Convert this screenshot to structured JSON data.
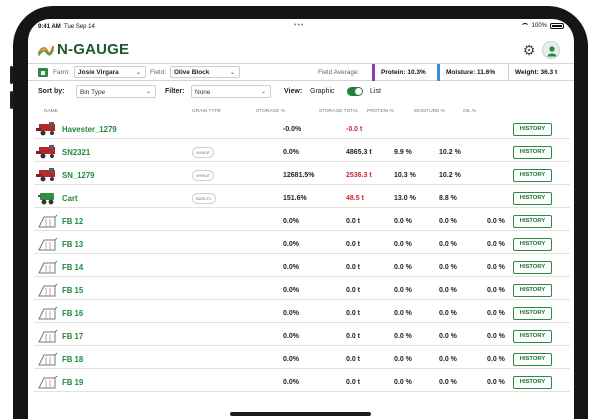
{
  "status_bar": {
    "time": "9:41 AM",
    "date": "Tue Sep 14",
    "battery": "100%"
  },
  "header": {
    "app_name": "N-GAUGE"
  },
  "field_bar": {
    "farm_label": "Farm:",
    "farm_value": "Josie Virgara",
    "field_label": "Field:",
    "field_value": "Olive Block",
    "field_average_label": "Field Average:",
    "protein": "Protein: 10.3%",
    "moisture": "Moisture: 11.6%",
    "weight": "Weight: 36.3 t"
  },
  "toolbar": {
    "sort_label": "Sort by:",
    "sort_value": "Bin Type",
    "filter_label": "Filter:",
    "filter_value": "None",
    "view_label": "View:",
    "view_graphic": "Graphic",
    "view_list": "List"
  },
  "table": {
    "columns": [
      "Name",
      "Grain type",
      "Storage %",
      "Storage total",
      "Protein %",
      "Moisture %",
      "Oil %"
    ],
    "history_label": "HISTORY",
    "rows": [
      {
        "name": "Havester_1279",
        "type": "harvester",
        "grain": "",
        "storage_pct": "-0.0%",
        "storage_total": "-0.0 t",
        "total_red": true,
        "protein": "",
        "moisture": "",
        "oil": ""
      },
      {
        "name": "SN2321",
        "type": "harvester",
        "grain": "WHEAT",
        "storage_pct": "0.0%",
        "storage_total": "4865.3 t",
        "total_red": false,
        "protein": "9.9 %",
        "moisture": "10.2 %",
        "oil": ""
      },
      {
        "name": "SN_1279",
        "type": "harvester",
        "grain": "WHEAT",
        "storage_pct": "12681.5%",
        "storage_total": "2536.3 t",
        "total_red": true,
        "protein": "10.3 %",
        "moisture": "10.2 %",
        "oil": ""
      },
      {
        "name": "Cart",
        "type": "cart",
        "grain": "BARLEY",
        "storage_pct": "151.6%",
        "storage_total": "48.5 t",
        "total_red": true,
        "protein": "13.0 %",
        "moisture": "8.8 %",
        "oil": ""
      },
      {
        "name": "FB 12",
        "type": "bin",
        "grain": "",
        "storage_pct": "0.0%",
        "storage_total": "0.0 t",
        "total_red": false,
        "protein": "0.0 %",
        "moisture": "0.0 %",
        "oil": "0.0 %"
      },
      {
        "name": "FB 13",
        "type": "bin",
        "grain": "",
        "storage_pct": "0.0%",
        "storage_total": "0.0 t",
        "total_red": false,
        "protein": "0.0 %",
        "moisture": "0.0 %",
        "oil": "0.0 %"
      },
      {
        "name": "FB 14",
        "type": "bin",
        "grain": "",
        "storage_pct": "0.0%",
        "storage_total": "0.0 t",
        "total_red": false,
        "protein": "0.0 %",
        "moisture": "0.0 %",
        "oil": "0.0 %"
      },
      {
        "name": "FB 15",
        "type": "bin",
        "grain": "",
        "storage_pct": "0.0%",
        "storage_total": "0.0 t",
        "total_red": false,
        "protein": "0.0 %",
        "moisture": "0.0 %",
        "oil": "0.0 %"
      },
      {
        "name": "FB 16",
        "type": "bin",
        "grain": "",
        "storage_pct": "0.0%",
        "storage_total": "0.0 t",
        "total_red": false,
        "protein": "0.0 %",
        "moisture": "0.0 %",
        "oil": "0.0 %"
      },
      {
        "name": "FB 17",
        "type": "bin",
        "grain": "",
        "storage_pct": "0.0%",
        "storage_total": "0.0 t",
        "total_red": false,
        "protein": "0.0 %",
        "moisture": "0.0 %",
        "oil": "0.0 %"
      },
      {
        "name": "FB 18",
        "type": "bin",
        "grain": "",
        "storage_pct": "0.0%",
        "storage_total": "0.0 t",
        "total_red": false,
        "protein": "0.0 %",
        "moisture": "0.0 %",
        "oil": "0.0 %"
      },
      {
        "name": "FB 19",
        "type": "bin",
        "grain": "",
        "storage_pct": "0.0%",
        "storage_total": "0.0 t",
        "total_red": false,
        "protein": "0.0 %",
        "moisture": "0.0 %",
        "oil": "0.0 %"
      }
    ]
  },
  "colors": {
    "brand_green": "#1e5632",
    "accent_green": "#1f8a3e",
    "alert_red": "#c8282c",
    "protein_bar": "#8a3ab9",
    "moisture_bar": "#3b8ed8",
    "weight_bar": "#cccccc"
  },
  "icons": {
    "settings": "gear-icon",
    "user": "user-icon",
    "harvester": "harvester-icon",
    "cart": "grain-cart-icon",
    "bin": "grain-bin-icon"
  }
}
